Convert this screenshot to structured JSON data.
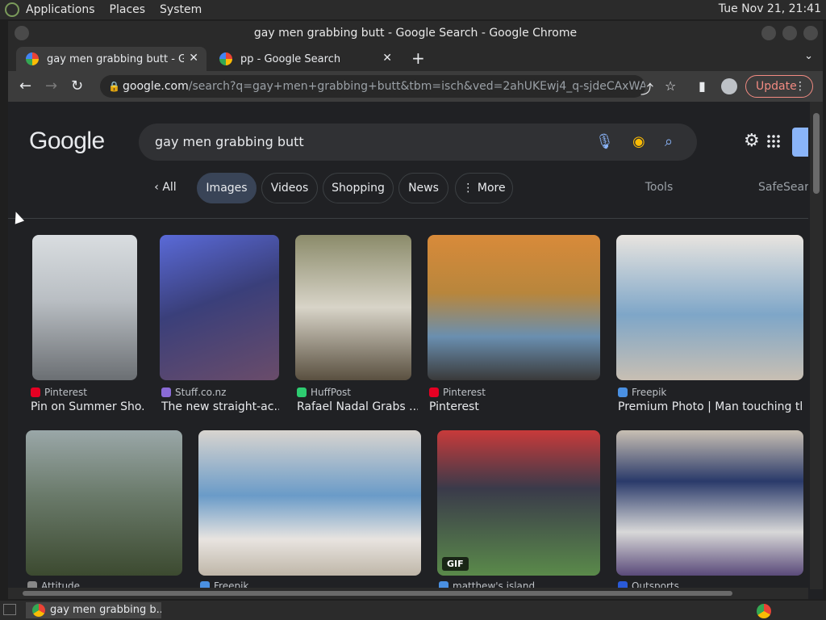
{
  "os": {
    "menus": [
      "Applications",
      "Places",
      "System"
    ],
    "clock": "Tue Nov 21, 21:41"
  },
  "window": {
    "title": "gay men grabbing butt - Google Search - Google Chrome"
  },
  "tabs": [
    {
      "title": "gay men grabbing butt - Google Search",
      "close": "✕"
    },
    {
      "title": "pp - Google Search",
      "close": "✕"
    }
  ],
  "toolbar": {
    "url_host": "google.com",
    "url_path": "/search?q=gay+men+grabbing+butt&tbm=isch&ved=2ahUKEwj4_q-sjdeCAxWAIGIAHT...",
    "update_label": "Update"
  },
  "search": {
    "logo": "Google",
    "query": "gay men grabbing butt"
  },
  "chips": {
    "all": "All",
    "images": "Images",
    "videos": "Videos",
    "shopping": "Shopping",
    "news": "News",
    "more": "More",
    "tools": "Tools",
    "safesearch": "SafeSearch"
  },
  "results": [
    {
      "source": "Pinterest",
      "caption": "Pin on Summer Sho..."
    },
    {
      "source": "Stuff.co.nz",
      "caption": "The new straight-ac..."
    },
    {
      "source": "HuffPost",
      "caption": "Rafael Nadal Grabs ..."
    },
    {
      "source": "Pinterest",
      "caption": "Pinterest"
    },
    {
      "source": "Freepik",
      "caption": "Premium Photo | Man touching th..."
    },
    {
      "source": "Attitude"
    },
    {
      "source": "Freepik"
    },
    {
      "source": "matthew's island",
      "badge": "GIF"
    },
    {
      "source": "Outsports"
    }
  ],
  "colors": {
    "pinterest": "#e60023",
    "stuff": "#8a6bd6",
    "huffpost": "#2ecc71",
    "freepik": "#4a90e2",
    "accent": "#8ab4f8"
  },
  "taskbar": {
    "item": "gay men grabbing b..."
  }
}
